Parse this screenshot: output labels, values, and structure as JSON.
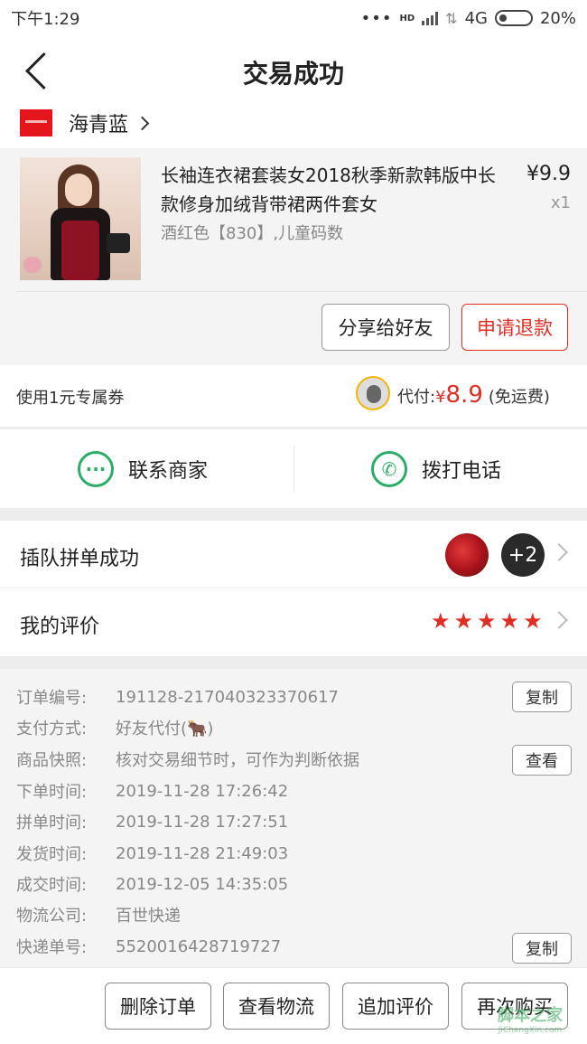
{
  "status_bar": {
    "time": "下午1:29",
    "dots": "•••",
    "hd": "HD",
    "network": "4G",
    "battery": "20%"
  },
  "nav": {
    "title": "交易成功"
  },
  "shop": {
    "name": "海青蓝"
  },
  "product": {
    "title": "长袖连衣裙套装女2018秋季新款韩版中长款修身加绒背带裙两件套女",
    "spec": "酒红色【830】,儿童码数",
    "price": "¥9.9",
    "qty": "x1",
    "share_btn": "分享给好友",
    "refund_btn": "申请退款"
  },
  "coupon": {
    "label": "使用1元专属券",
    "pay_label": "代付:",
    "pay_currency": "¥",
    "pay_amount": "8.9",
    "shipping": "(免运费)"
  },
  "contact": {
    "merchant": "联系商家",
    "phone": "拨打电话"
  },
  "group": {
    "label": "插队拼单成功",
    "more": "+2"
  },
  "review": {
    "label": "我的评价",
    "stars": 5
  },
  "order_info": {
    "rows": [
      {
        "k": "订单编号:",
        "v": "191128-217040323370617"
      },
      {
        "k": "支付方式:",
        "v": "好友代付(🐂)"
      },
      {
        "k": "商品快照:",
        "v": "核对交易细节时，可作为判断依据"
      },
      {
        "k": "下单时间:",
        "v": "2019-11-28 17:26:42"
      },
      {
        "k": "拼单时间:",
        "v": "2019-11-28 17:27:51"
      },
      {
        "k": "发货时间:",
        "v": "2019-11-28 21:49:03"
      },
      {
        "k": "成交时间:",
        "v": "2019-12-05 14:35:05"
      },
      {
        "k": "物流公司:",
        "v": "百世快递"
      },
      {
        "k": "快递单号:",
        "v": "5520016428719727"
      }
    ],
    "copy_label": "复制",
    "view_label": "查看"
  },
  "bottom": {
    "delete": "删除订单",
    "logistics": "查看物流",
    "add_review": "追加评价",
    "rebuy": "再次购买"
  },
  "watermark": {
    "main": "脚本之家",
    "sub": "JiChengXin.com"
  },
  "colors": {
    "accent_red": "#e02e24",
    "wechat_green": "#2aae67",
    "star": "#e02e24"
  }
}
